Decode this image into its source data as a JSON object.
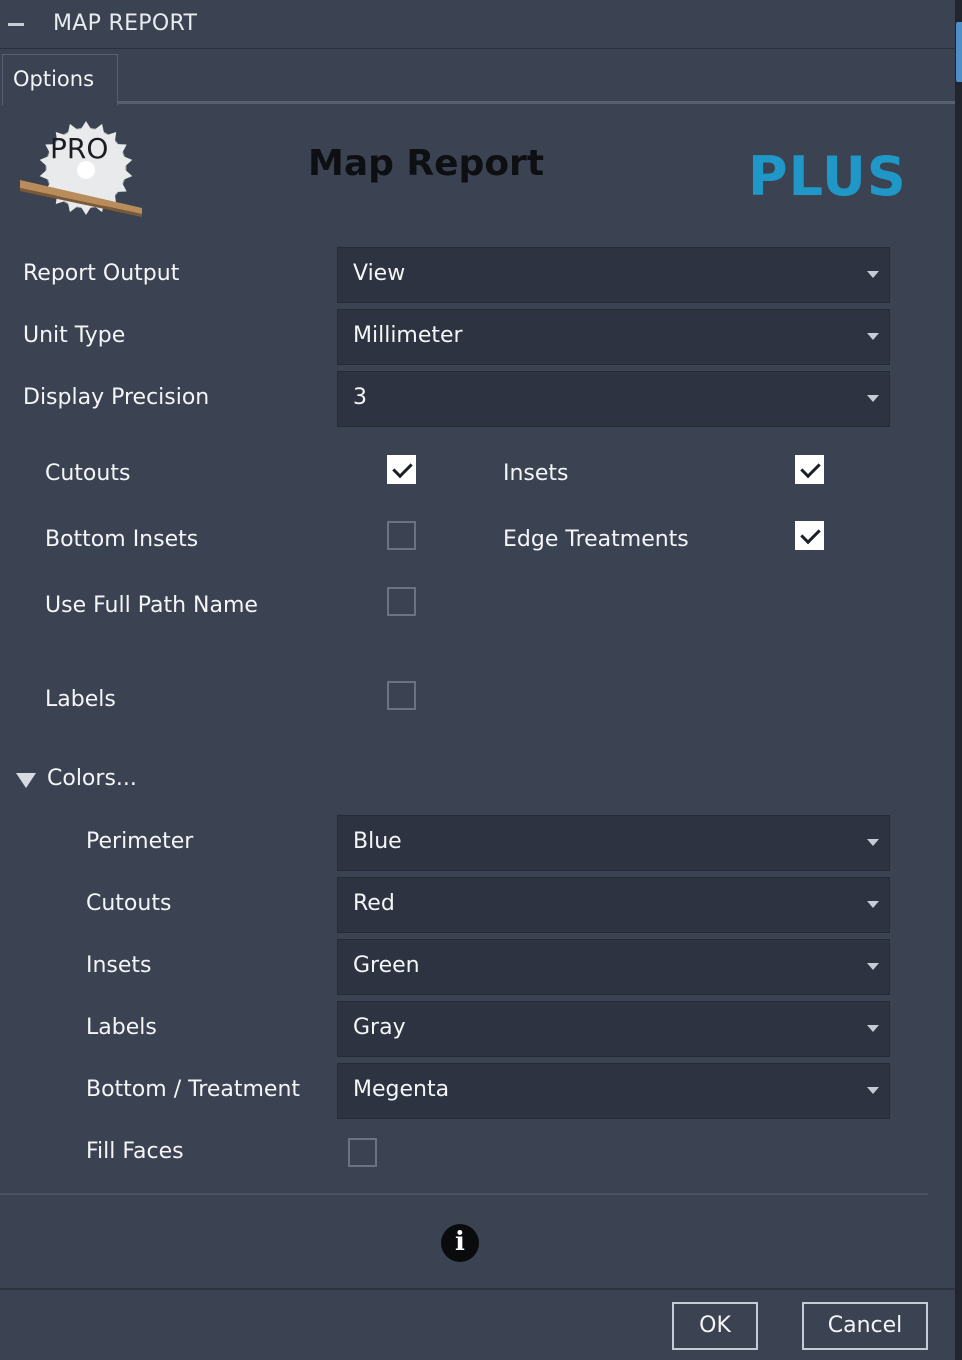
{
  "window": {
    "title": "MAP REPORT"
  },
  "tabs": [
    {
      "label": "Options"
    }
  ],
  "header": {
    "logo_text": "PRO",
    "title": "Map Report",
    "badge": "PLUS"
  },
  "fields": {
    "report_output": {
      "label": "Report Output",
      "value": "View"
    },
    "unit_type": {
      "label": "Unit Type",
      "value": "Millimeter"
    },
    "display_precision": {
      "label": "Display Precision",
      "value": "3"
    }
  },
  "options": {
    "cutouts": {
      "label": "Cutouts",
      "checked": true
    },
    "insets": {
      "label": "Insets",
      "checked": true
    },
    "bottom_insets": {
      "label": "Bottom Insets",
      "checked": false
    },
    "edge_treatments": {
      "label": "Edge Treatments",
      "checked": true
    },
    "use_full_path_name": {
      "label": "Use Full Path Name",
      "checked": false
    },
    "labels": {
      "label": "Labels",
      "checked": false
    }
  },
  "colors": {
    "section_label": "Colors...",
    "perimeter": {
      "label": "Perimeter",
      "value": "Blue"
    },
    "cutouts": {
      "label": "Cutouts",
      "value": "Red"
    },
    "insets": {
      "label": "Insets",
      "value": "Green"
    },
    "labels": {
      "label": "Labels",
      "value": "Gray"
    },
    "bottom_treatment": {
      "label": "Bottom / Treatment",
      "value": "Megenta"
    },
    "fill_faces": {
      "label": "Fill Faces",
      "checked": false
    }
  },
  "footer": {
    "ok_label": "OK",
    "cancel_label": "Cancel"
  },
  "theme": {
    "panel_bg": "#3b4352",
    "field_bg": "#2d3340",
    "accent": "#1f97c7"
  }
}
